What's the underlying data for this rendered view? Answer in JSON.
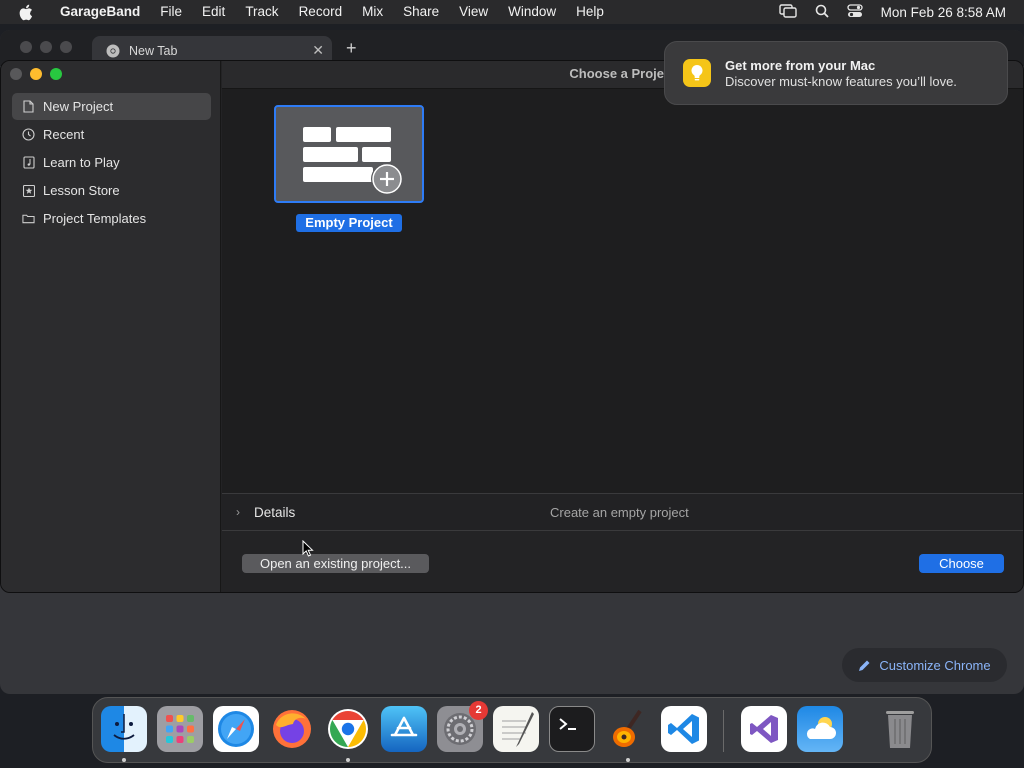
{
  "menubar": {
    "app_name": "GarageBand",
    "items": [
      "File",
      "Edit",
      "Track",
      "Record",
      "Mix",
      "Share",
      "View",
      "Window",
      "Help"
    ],
    "clock": "Mon Feb 26  8:58 AM"
  },
  "chrome": {
    "tab_title": "New Tab",
    "customize_label": "Customize Chrome",
    "accent_color": "#8ab4f8"
  },
  "garageband": {
    "window_title": "Choose a Project",
    "sidebar": {
      "items": [
        {
          "label": "New Project",
          "icon": "document-icon",
          "selected": true
        },
        {
          "label": "Recent",
          "icon": "clock-icon",
          "selected": false
        },
        {
          "label": "Learn to Play",
          "icon": "music-book-icon",
          "selected": false
        },
        {
          "label": "Lesson Store",
          "icon": "star-box-icon",
          "selected": false
        },
        {
          "label": "Project Templates",
          "icon": "folder-icon",
          "selected": false
        }
      ]
    },
    "template": {
      "label": "Empty Project"
    },
    "details": {
      "label": "Details",
      "description": "Create an empty project"
    },
    "buttons": {
      "open_existing": "Open an existing project...",
      "choose": "Choose"
    },
    "accent_color": "#1f6fe5"
  },
  "notification": {
    "title": "Get more from your Mac",
    "body": "Discover must-know features you’ll love."
  },
  "dock": {
    "apps": [
      {
        "name": "Finder",
        "running": true
      },
      {
        "name": "Launchpad",
        "running": false
      },
      {
        "name": "Safari",
        "running": false
      },
      {
        "name": "Firefox",
        "running": false
      },
      {
        "name": "Google Chrome",
        "running": true
      },
      {
        "name": "App Store",
        "running": false
      },
      {
        "name": "System Settings",
        "running": false,
        "badge": "2"
      },
      {
        "name": "TextEdit",
        "running": false
      },
      {
        "name": "Terminal",
        "running": false
      },
      {
        "name": "GarageBand",
        "running": true
      },
      {
        "name": "Visual Studio Code",
        "running": false
      },
      {
        "name": "Visual Studio",
        "running": false
      },
      {
        "name": "Weather",
        "running": false
      },
      {
        "name": "Trash",
        "running": false
      }
    ]
  }
}
